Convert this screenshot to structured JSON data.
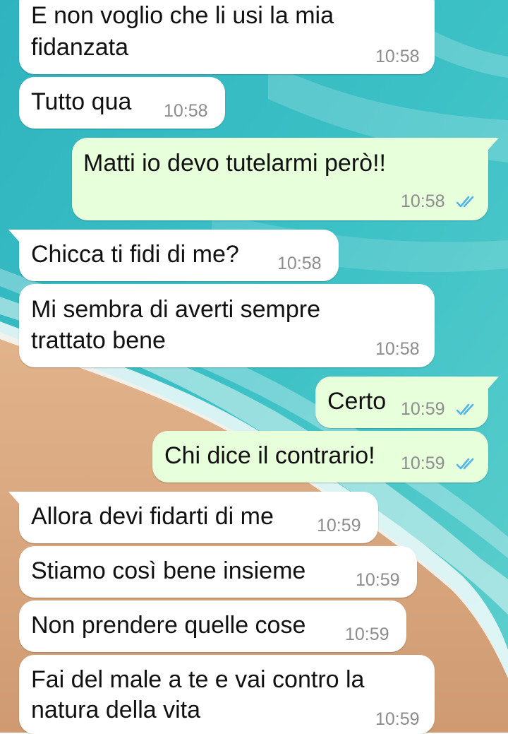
{
  "colors": {
    "incoming_bubble": "#ffffff",
    "outgoing_bubble": "#e7ffdb",
    "read_ticks": "#4fb6ec",
    "time_text": "#8c8c8c",
    "sea": "#33b8c0",
    "sand": "#d9a87e"
  },
  "ticks_icon": "double-check-read",
  "messages": [
    {
      "direction": "incoming",
      "lines": [
        "E non voglio che li usi la mia",
        "fidanzata"
      ],
      "time": "10:58"
    },
    {
      "direction": "incoming",
      "lines": [
        "Tutto qua"
      ],
      "time": "10:58"
    },
    {
      "direction": "outgoing",
      "lines": [
        "Matti io devo tutelarmi però!!"
      ],
      "time": "10:58",
      "read": true
    },
    {
      "direction": "incoming",
      "lines": [
        "Chicca ti fidi di me?"
      ],
      "time": "10:58"
    },
    {
      "direction": "incoming",
      "lines": [
        "Mi sembra di averti sempre",
        "trattato bene"
      ],
      "time": "10:58"
    },
    {
      "direction": "outgoing",
      "lines": [
        "Certo"
      ],
      "time": "10:59",
      "read": true
    },
    {
      "direction": "outgoing",
      "lines": [
        "Chi dice il contrario!"
      ],
      "time": "10:59",
      "read": true
    },
    {
      "direction": "incoming",
      "lines": [
        "Allora devi fidarti di me"
      ],
      "time": "10:59"
    },
    {
      "direction": "incoming",
      "lines": [
        "Stiamo così bene insieme"
      ],
      "time": "10:59"
    },
    {
      "direction": "incoming",
      "lines": [
        "Non prendere quelle cose"
      ],
      "time": "10:59"
    },
    {
      "direction": "incoming",
      "lines": [
        "Fai del male a te e vai contro la",
        "natura della vita"
      ],
      "time": "10:59"
    }
  ]
}
